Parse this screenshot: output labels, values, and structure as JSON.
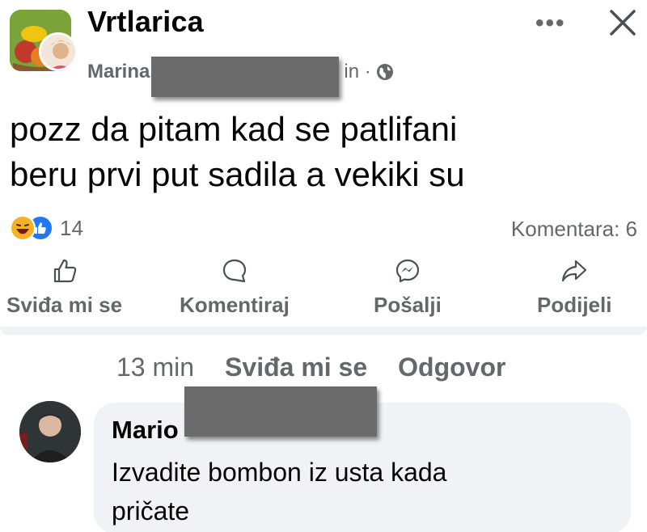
{
  "post": {
    "group_name": "Vrtlarica",
    "author_first_name": "Marina",
    "meta_tail": "in ·",
    "text_line1": "pozz da pitam kad se patlifani",
    "text_line2": "beru prvi put sadila a vekiki su",
    "more_label": "•••",
    "reaction_count": "14",
    "comments_label": "Komentara: 6"
  },
  "actions": {
    "like": "Sviđa mi se",
    "comment": "Komentiraj",
    "send": "Pošalji",
    "share": "Podijeli"
  },
  "comment": {
    "time": "13 min",
    "like_label": "Sviđa mi se",
    "reply_label": "Odgovor",
    "author_visible": "Mario",
    "text_line1": "Izvadite bombon iz usta kada",
    "text_line2": "pričate"
  },
  "icons": {
    "group_avatar": "vegetable-basket-icon",
    "member_avatar": "user-avatar-icon",
    "globe": "globe-icon",
    "more": "more-dots-icon",
    "close": "close-icon",
    "haha": "haha-reaction-icon",
    "like_reaction": "like-reaction-icon",
    "like_action": "thumbs-up-icon",
    "comment_action": "speech-bubble-icon",
    "send_action": "messenger-icon",
    "share_action": "share-arrow-icon"
  },
  "colors": {
    "text_primary": "#050505",
    "text_secondary": "#65676b",
    "like_blue": "#2078f4",
    "haha_yellow": "#f7b125",
    "bubble_bg": "#f0f2f5",
    "redaction_gray": "#6b6b6b"
  }
}
